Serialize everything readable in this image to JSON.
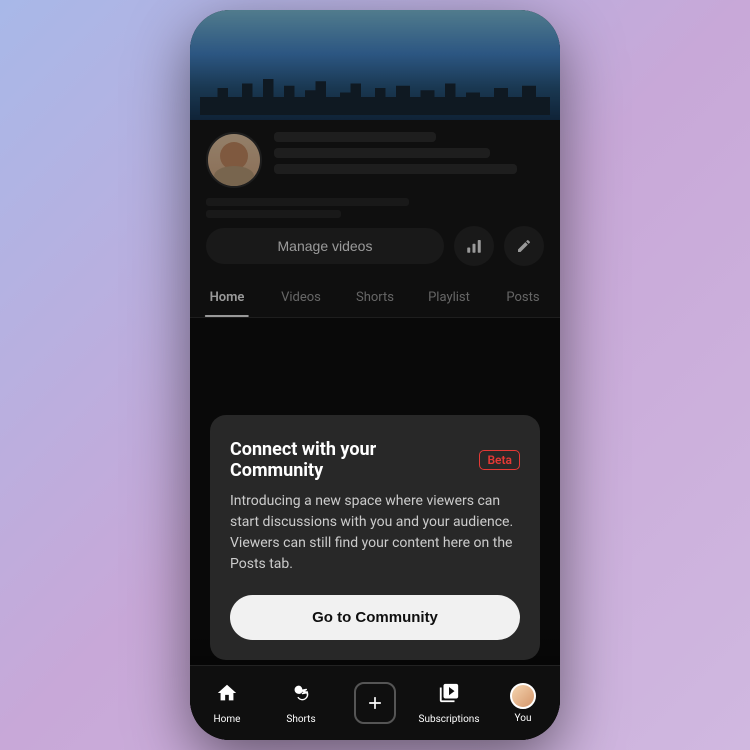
{
  "phone": {
    "banner_alt": "City skyline banner"
  },
  "channel": {
    "manage_btn_label": "Manage videos",
    "tabs": [
      {
        "label": "Home",
        "active": true
      },
      {
        "label": "Videos",
        "active": false
      },
      {
        "label": "Shorts",
        "active": false
      },
      {
        "label": "Playlist",
        "active": false
      },
      {
        "label": "Posts",
        "active": false
      }
    ]
  },
  "popup": {
    "title": "Connect with your Community",
    "beta_label": "Beta",
    "description": "Introducing a new space where viewers can start discussions with you and your audience. Viewers can still find your content here on the Posts tab.",
    "cta_label": "Go to Community"
  },
  "bottom_nav": {
    "items": [
      {
        "label": "Home",
        "icon": "🏠"
      },
      {
        "label": "Shorts",
        "icon": "⚡"
      },
      {
        "label": "",
        "icon": "+"
      },
      {
        "label": "Subscriptions",
        "icon": "📺"
      },
      {
        "label": "You",
        "icon": "👤"
      }
    ]
  }
}
